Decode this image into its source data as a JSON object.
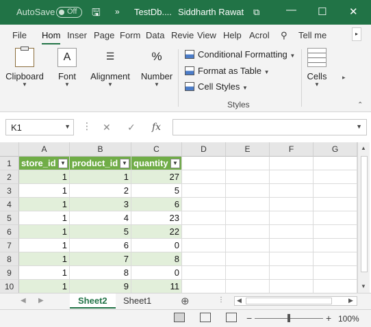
{
  "titlebar": {
    "autosave_label": "AutoSave",
    "autosave_state": "Off",
    "doc_title": "TestDb....",
    "user_name": "Siddharth Rawat",
    "accent": "#217346"
  },
  "ribbon_tabs": [
    "File",
    "Hom",
    "Inser",
    "Page",
    "Form",
    "Data",
    "Revie",
    "View",
    "Help",
    "Acrol",
    "Tell me"
  ],
  "active_tab": "Hom",
  "ribbon": {
    "clipboard": "Clipboard",
    "font": "Font",
    "alignment": "Alignment",
    "number": "Number",
    "number_icon": "%",
    "conditional_formatting": "Conditional Formatting",
    "format_as_table": "Format as Table",
    "cell_styles": "Cell Styles",
    "styles_group": "Styles",
    "cells": "Cells"
  },
  "formula_bar": {
    "name_box": "K1",
    "formula": "",
    "fx_label": "fx"
  },
  "columns": [
    "A",
    "B",
    "C",
    "D",
    "E",
    "F",
    "G"
  ],
  "row_numbers": [
    "1",
    "2",
    "3",
    "4",
    "5",
    "6",
    "7",
    "8",
    "9",
    "10"
  ],
  "table": {
    "headers": [
      "store_id",
      "product_id",
      "quantity"
    ],
    "rows": [
      [
        "1",
        "1",
        "27"
      ],
      [
        "1",
        "2",
        "5"
      ],
      [
        "1",
        "3",
        "6"
      ],
      [
        "1",
        "4",
        "23"
      ],
      [
        "1",
        "5",
        "22"
      ],
      [
        "1",
        "6",
        "0"
      ],
      [
        "1",
        "7",
        "8"
      ],
      [
        "1",
        "8",
        "0"
      ],
      [
        "1",
        "9",
        "11"
      ]
    ],
    "header_color": "#70ad47",
    "band_color": "#e2efda"
  },
  "sheets": [
    "Sheet2",
    "Sheet1"
  ],
  "active_sheet": "Sheet2",
  "status": {
    "zoom": "100%"
  }
}
